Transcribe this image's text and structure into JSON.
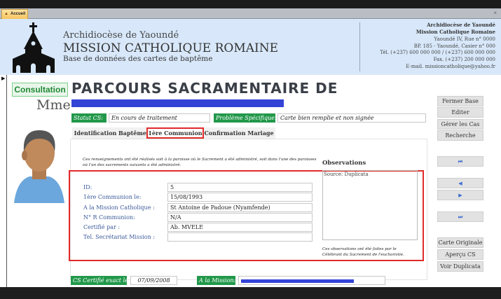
{
  "tab": {
    "label": "Accueil",
    "close": "×"
  },
  "header": {
    "diocese": "Archidiocèse de Yaoundé",
    "mission": "MISSION CATHOLIQUE ROMAINE",
    "subtitle": "Base de données des cartes de baptême",
    "contact": {
      "line1": "Archidiocèse de Yaoundé",
      "line2": "Mission Catholique Romaine",
      "line3": "Yaoundé IV, Rue n° 0000",
      "line4": "BP. 185 - Yaoundé, Casier n° 000",
      "line5": "Tél. (+237) 600 000 000 / (+237) 600 000 000",
      "line6": "Fax. (+237) 200 000 000",
      "line7": "E-mail. missioncatholique@yahoo.fr"
    }
  },
  "form": {
    "mode": "Consultation",
    "title": "PARCOURS SACRAMENTAIRE DE",
    "civility": "Mme",
    "statut_label": "Statut CS:",
    "statut_value": "En cours de traitement",
    "probleme_label": "Problème Spécifique:",
    "probleme_value": "Carte bien remplie et non signée",
    "tabs": [
      "Identification",
      "Baptême",
      "1ère Communion",
      "Confirmation",
      "Mariage"
    ],
    "note": "Ces renseignements ont été réalisés soit à la paroisse où le Sacrement a été administré, soit dans l'une des paroisses où l'un des sacrements suivants a été administré.",
    "fields": [
      {
        "label": "ID:",
        "value": "5"
      },
      {
        "label": "1ère Communion le:",
        "value": "15/08/1993"
      },
      {
        "label": "A la Mission Catholique :",
        "value": "St Antoine de Padoue (Nyamfende)"
      },
      {
        "label": "N° R Communion:",
        "value": "N/A"
      },
      {
        "label": "Certifié par :",
        "value": "Ab. MVELE"
      },
      {
        "label": "Tel. Secrétariat Mission :",
        "value": ""
      }
    ],
    "observations_label": "Observations",
    "observations_value": "Source: Duplicata",
    "observations_note": "Ces observations ont été faites par le Célébrant du Sacrement de l'eucharistie.",
    "certifie_label": "CS Certifié exact le:",
    "certifie_value": "07/09/2008",
    "mission_label": "A la Mission:"
  },
  "buttons": {
    "fermer": "Fermer Base",
    "editer": "Editer",
    "gerer": "Gérer les Cas",
    "recherche": "Recherche",
    "first": "⏮",
    "prev": "◀",
    "next": "▶",
    "last": "⏭",
    "carte": "Carte Originale",
    "apercu": "Aperçu CS",
    "duplicata": "Voir Duplicata"
  }
}
